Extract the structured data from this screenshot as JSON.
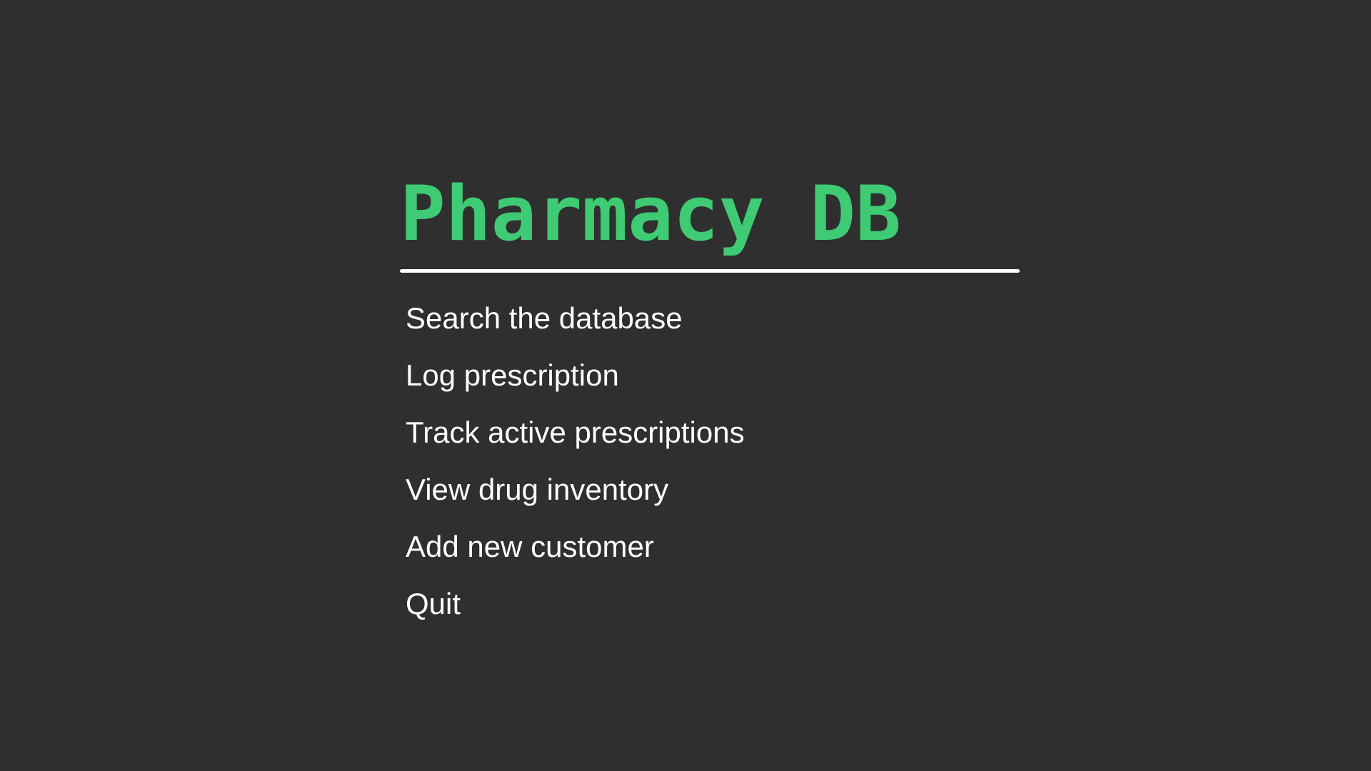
{
  "app": {
    "title": "Pharmacy DB"
  },
  "colors": {
    "background": "#2f2f2f",
    "accent": "#3ecb74",
    "text": "#ffffff",
    "rule": "#ffffff"
  },
  "menu": {
    "items": [
      {
        "label": "Search the database"
      },
      {
        "label": "Log prescription"
      },
      {
        "label": "Track active prescriptions"
      },
      {
        "label": "View drug inventory"
      },
      {
        "label": "Add new customer"
      },
      {
        "label": "Quit"
      }
    ]
  }
}
